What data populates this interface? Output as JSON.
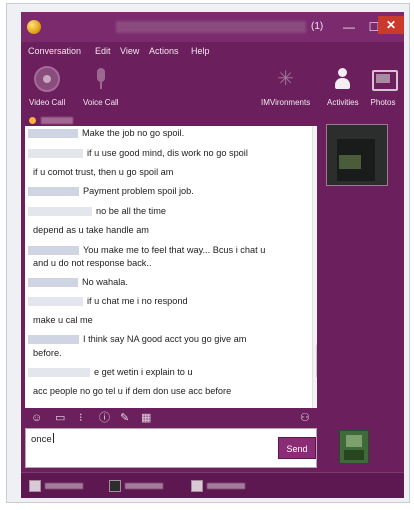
{
  "window": {
    "title_count": "(1)",
    "controls": {
      "minimize": "—",
      "maximize": "☐",
      "close": "✕"
    }
  },
  "menu": [
    "Conversation",
    "Edit",
    "View",
    "Actions",
    "Help"
  ],
  "toolbar": {
    "video_call": "Video Call",
    "voice_call": "Voice Call",
    "imvironments": "IMVironments",
    "activities": "Activities",
    "photos": "Photos"
  },
  "messages": [
    {
      "text": "Make the job no go spoil."
    },
    {
      "text": "if u use good mind, dis work no go spoil"
    },
    {
      "text": "if u comot trust, then u go spoil am"
    },
    {
      "text": "Payment problem spoil job."
    },
    {
      "text": "no be all the time"
    },
    {
      "text": "depend as u take handle am"
    },
    {
      "text": "You make me to feel that way... Bcus i chat u"
    },
    {
      "text": "and u do not response back.."
    },
    {
      "text": "No wahala."
    },
    {
      "text": "if u chat me i no respond"
    },
    {
      "text": "make u cal me"
    },
    {
      "text": "I think say NA good acct you go give am"
    },
    {
      "text": "before."
    },
    {
      "text": "e get wetin i explain to u"
    },
    {
      "text": "acc people no go tel u if dem don use acc before"
    }
  ],
  "composer": {
    "value": "once",
    "send_label": "Send"
  },
  "icons": {
    "app": "messenger-icon",
    "video": "video-call-icon",
    "voice": "microphone-icon",
    "imvironments": "imvironments-icon",
    "activities": "activities-icon",
    "photos": "photos-icon"
  },
  "colors": {
    "window_bg": "#6b1f5c",
    "accent": "#8b2d76",
    "status_online": "#f7b23b",
    "close_button": "#c93a2c"
  }
}
